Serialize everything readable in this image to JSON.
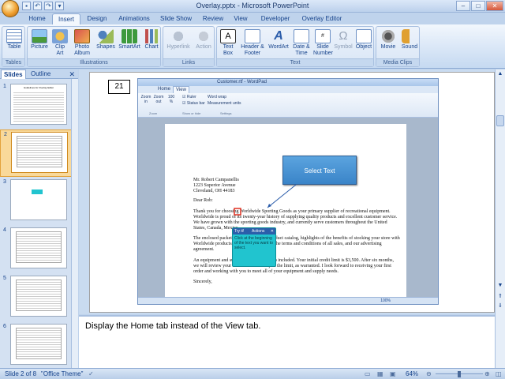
{
  "window": {
    "title": "Overlay.pptx - Microsoft PowerPoint"
  },
  "quick_access": [
    "save-icon",
    "undo-icon",
    "redo-icon",
    "dropdown-icon"
  ],
  "tabs": [
    {
      "label": "Home"
    },
    {
      "label": "Insert",
      "active": true
    },
    {
      "label": "Design"
    },
    {
      "label": "Animations"
    },
    {
      "label": "Slide Show"
    },
    {
      "label": "Review"
    },
    {
      "label": "View"
    },
    {
      "label": "Developer"
    },
    {
      "label": "Overlay Editor"
    }
  ],
  "ribbon": {
    "groups": [
      {
        "label": "Tables",
        "buttons": [
          {
            "label": "Table",
            "icon": "table-icon"
          }
        ]
      },
      {
        "label": "Illustrations",
        "buttons": [
          {
            "label": "Picture",
            "icon": "picture-icon"
          },
          {
            "label": "Clip Art",
            "icon": "clip-art-icon"
          },
          {
            "label": "Photo Album",
            "icon": "photo-album-icon"
          },
          {
            "label": "Shapes",
            "icon": "shapes-icon"
          },
          {
            "label": "SmartArt",
            "icon": "smartart-icon"
          },
          {
            "label": "Chart",
            "icon": "chart-icon"
          }
        ]
      },
      {
        "label": "Links",
        "buttons": [
          {
            "label": "Hyperlink",
            "icon": "hyperlink-icon",
            "disabled": true
          },
          {
            "label": "Action",
            "icon": "action-icon",
            "disabled": true
          }
        ]
      },
      {
        "label": "Text",
        "buttons": [
          {
            "label": "Text Box",
            "icon": "text-box-icon"
          },
          {
            "label": "Header & Footer",
            "icon": "header-footer-icon"
          },
          {
            "label": "WordArt",
            "icon": "wordart-icon"
          },
          {
            "label": "Date & Time",
            "icon": "date-time-icon"
          },
          {
            "label": "Slide Number",
            "icon": "slide-number-icon"
          },
          {
            "label": "Symbol",
            "icon": "symbol-icon",
            "disabled": true
          },
          {
            "label": "Object",
            "icon": "object-icon"
          }
        ]
      },
      {
        "label": "Media Clips",
        "buttons": [
          {
            "label": "Movie",
            "icon": "movie-icon"
          },
          {
            "label": "Sound",
            "icon": "sound-icon"
          }
        ]
      }
    ]
  },
  "slides_panel": {
    "tabs": [
      "Slides",
      "Outline"
    ],
    "thumbnails": [
      {
        "num": "1",
        "heading": "Guidelines for Overlay Editor"
      },
      {
        "num": "2",
        "selected": true
      },
      {
        "num": "3"
      },
      {
        "num": "4"
      },
      {
        "num": "5"
      },
      {
        "num": "6"
      }
    ]
  },
  "slide": {
    "number_box": "21",
    "wordpad": {
      "title": "Customer.rtf - WordPad",
      "tabs": [
        "Home",
        "View"
      ],
      "ribbon": {
        "zoom_buttons": [
          "Zoom in",
          "Zoom out",
          "100 %"
        ],
        "checkboxes": [
          "Ruler",
          "Status bar"
        ],
        "options": [
          "Word wrap",
          "Measurement units"
        ],
        "groups": [
          "Zoom",
          "Show or hide",
          "Settings"
        ]
      },
      "document": {
        "address": [
          "Mr. Robert Campanellis",
          "1223 Superior Avenue",
          "Cleveland, OH  44183"
        ],
        "greeting": "Dear Rob:",
        "para1": "Thank you for choosing Worldwide Sporting Goods as your primary supplier of recreational equipment. Worldwide is proud of its twenty-year history of supplying quality products and excellent customer service. We have grown with the sporting goods industry, and currently serve customers throughout the United States, Canada, Mexico.",
        "para2": "The enclosed packet contains our latest product catalog, highlights of the benefits of stocking your store with Worldwide products, a price list, details of the terms and conditions of all sales, and our advertising agreement.",
        "para3": "An equipment and supply order form is also included. Your initial credit limit is $3,500. After six months, we will review your credit status and adjust the limit, as warranted. I look forward to receiving your first order and working with you to meet all of your equipment and supply needs.",
        "closing": "Sincerely,"
      },
      "status_zoom": "100%"
    },
    "callout": "Select Text",
    "tryit": {
      "title": "Try it!",
      "action": "Actions",
      "body": "Click at the beginning of the text you want to select."
    }
  },
  "notes": "Display the Home tab instead of the View tab.",
  "statusbar": {
    "slide_info": "Slide 2 of 8",
    "theme": "\"Office Theme\"",
    "zoom": "64%"
  }
}
